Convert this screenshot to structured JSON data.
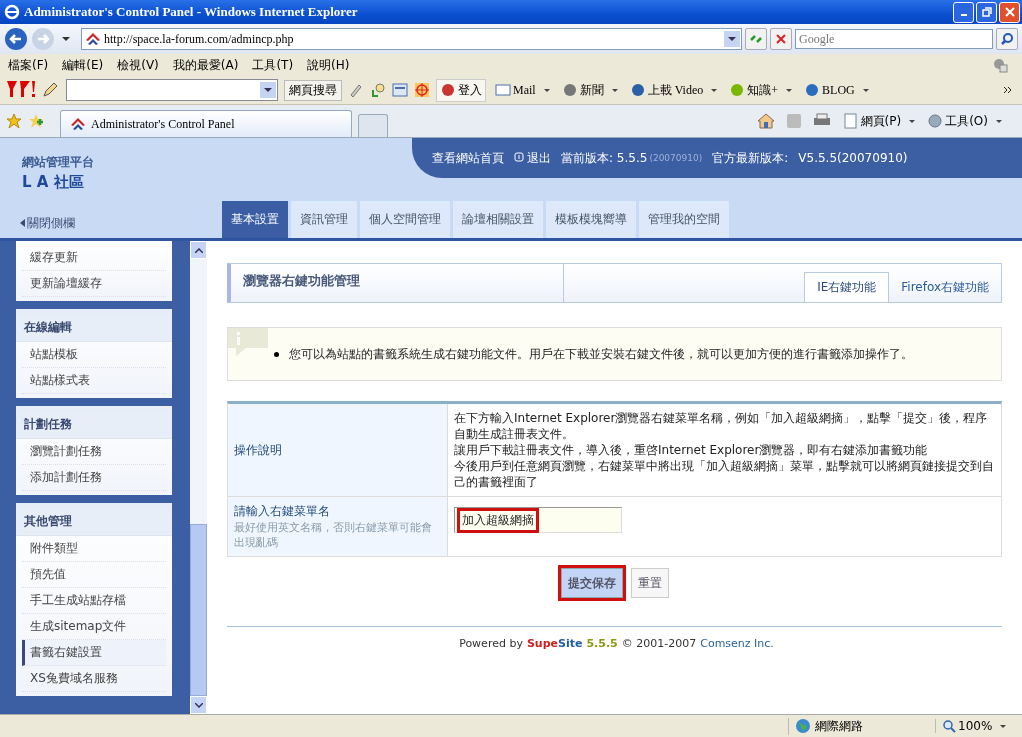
{
  "window": {
    "title": "Administrator's Control Panel - Windows Internet Explorer"
  },
  "address_bar": {
    "url": "http://space.la-forum.com/admincp.php"
  },
  "search_box": {
    "placeholder": "Google"
  },
  "menu_bar": [
    "檔案(F)",
    "編輯(E)",
    "檢視(V)",
    "我的最愛(A)",
    "工具(T)",
    "說明(H)"
  ],
  "yahoo_toolbar": {
    "search_button": "網頁搜尋",
    "items": [
      {
        "label": "登入",
        "kind": "login"
      },
      {
        "label": "Mail",
        "kind": "mail"
      },
      {
        "label": "新聞",
        "kind": "news"
      },
      {
        "label": "上載 Video",
        "kind": "video"
      },
      {
        "label": "知識+",
        "kind": "knowledge"
      },
      {
        "label": "BLOG",
        "kind": "blog"
      }
    ]
  },
  "browser_tab": {
    "title": "Administrator's Control Panel"
  },
  "command_bar": [
    {
      "label": "網頁(P)",
      "kind": "page"
    },
    {
      "label": "工具(O)",
      "kind": "tools"
    }
  ],
  "site": {
    "platform": "網站管理平台",
    "name": "L A 社區",
    "close_sidebar": "關閉側欄",
    "view_site": "查看網站首頁",
    "logout": "退出",
    "current_version": "當前版本: 5.5.5",
    "current_date": "(20070910)",
    "latest_label": "官方最新版本:",
    "latest_version": "V5.5.5(20070910)"
  },
  "main_tabs": [
    {
      "label": "基本設置",
      "selected": true
    },
    {
      "label": "資訊管理",
      "selected": false
    },
    {
      "label": "個人空間管理",
      "selected": false
    },
    {
      "label": "論壇相關設置",
      "selected": false
    },
    {
      "label": "模板模塊嚮導",
      "selected": false
    },
    {
      "label": "管理我的空間",
      "selected": false
    }
  ],
  "sidebar": {
    "groups": [
      {
        "items": [
          {
            "label": "緩存更新",
            "selected": false
          },
          {
            "label": "更新論壇緩存",
            "selected": false
          }
        ]
      },
      {
        "title": "在線編輯",
        "items": [
          {
            "label": "站點模板",
            "selected": false
          },
          {
            "label": "站點樣式表",
            "selected": false
          }
        ]
      },
      {
        "title": "計劃任務",
        "items": [
          {
            "label": "瀏覽計劃任務",
            "selected": false
          },
          {
            "label": "添加計劃任務",
            "selected": false
          }
        ]
      },
      {
        "title": "其他管理",
        "items": [
          {
            "label": "附件類型",
            "selected": false
          },
          {
            "label": "預先值",
            "selected": false
          },
          {
            "label": "手工生成站點存檔",
            "selected": false
          },
          {
            "label": "生成sitemap文件",
            "selected": false
          },
          {
            "label": "書籤右鍵設置",
            "selected": true
          },
          {
            "label": "XS兔費域名服務",
            "selected": false
          }
        ]
      }
    ]
  },
  "panel": {
    "title": "瀏覽器右鍵功能管理",
    "tabs": [
      {
        "label": "IE右鍵功能",
        "selected": true
      },
      {
        "label": "Firefox右鍵功能",
        "selected": false
      }
    ]
  },
  "notice": "您可以為站點的書籤系統生成右鍵功能文件。用戶在下載並安裝右鍵文件後，就可以更加方便的進行書籤添加操作了。",
  "form": {
    "rows": [
      {
        "kind": "text",
        "label": "操作說明",
        "lines": [
          "在下方輸入Internet Explorer瀏覽器右鍵菜單名稱，例如「加入超級網摘」，點擊「提交」後，程序自動生成註冊表文件。",
          "讓用戶下載註冊表文件，導入後，重啓Internet Explorer瀏覽器，即有右鍵添加書籤功能",
          "今後用戶到任意網頁瀏覽，右鍵菜單中將出現「加入超級網摘」菜單，點擊就可以將網頁鏈接提交到自己的書籤裡面了"
        ]
      },
      {
        "kind": "input",
        "label": "請輸入右鍵菜單名",
        "hint": "最好使用英文名稱，否則右鍵菜單可能會出現亂碼",
        "value": "加入超級網摘",
        "highlighted": true
      }
    ]
  },
  "buttons": [
    {
      "label": "提交保存",
      "kind": "submit",
      "highlighted": true
    },
    {
      "label": "重置",
      "kind": "reset",
      "highlighted": false
    }
  ],
  "footer": [
    {
      "text": "Powered by",
      "color": "#333333"
    },
    {
      "text": "Supe",
      "color": "#cc2222"
    },
    {
      "text": "Site",
      "color": "#1f5fa0"
    },
    {
      "text": "5.5.5",
      "color": "#8a9a10"
    },
    {
      "text": "© 2001-2007",
      "color": "#333333"
    },
    {
      "text": "Comsenz Inc.",
      "color": "#2a6496"
    }
  ],
  "status_bar": {
    "zone": "網際網路",
    "zoom": "100%"
  }
}
